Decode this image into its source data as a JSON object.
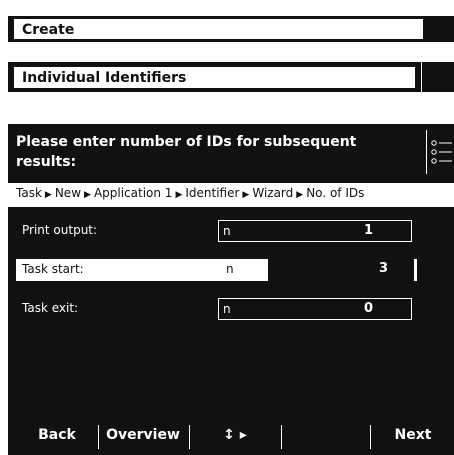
{
  "top_bar": {
    "title": "Create"
  },
  "sub_bar": {
    "title": "Individual Identifiers"
  },
  "header": {
    "prompt": "Please enter number of IDs for subsequent results:",
    "menu_icon": "list-menu-icon"
  },
  "breadcrumb": [
    "Task",
    "New",
    "Application 1",
    "Identifier",
    "Wizard",
    "No. of IDs"
  ],
  "fields": [
    {
      "label": "Print output:",
      "unit": "n",
      "value": "1",
      "selected": false
    },
    {
      "label": "Task start:",
      "unit": "n",
      "value": "3",
      "selected": true
    },
    {
      "label": "Task exit:",
      "unit": "n",
      "value": "0",
      "selected": false
    }
  ],
  "softkeys": {
    "back": "Back",
    "overview": "Overview",
    "nav": "↕ ▸",
    "next": "Next"
  }
}
